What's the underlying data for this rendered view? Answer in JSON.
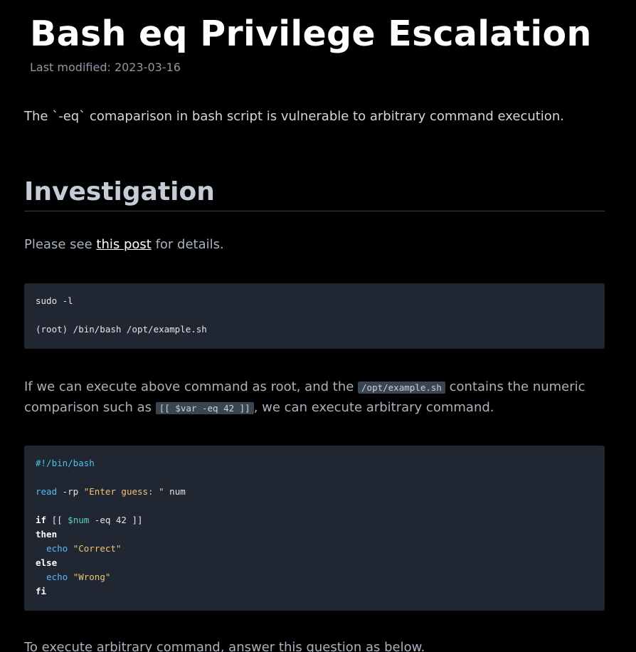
{
  "page": {
    "title": "Bash eq Privilege Escalation",
    "last_modified": "Last modified: 2023-03-16"
  },
  "intro": "The `-eq` comaparison in bash script is vulnerable to arbitrary command execution.",
  "investigation": {
    "heading": "Investigation",
    "see_prefix": "Please see ",
    "see_link": "this post",
    "see_suffix": " for details.",
    "code1": {
      "line1": "sudo -l",
      "line2": "(root) /bin/bash /opt/example.sh"
    },
    "para2": {
      "part1": "If we can execute above command as root, and the ",
      "code_a": "/opt/example.sh",
      "part2": " contains the numeric comparison such as ",
      "code_b": "[[ $var -eq 42 ]]",
      "part3": ", we can execute arbitrary command."
    },
    "code2": {
      "shebang": "#!/bin/bash",
      "read_kw": "read",
      "read_args": " -rp ",
      "read_prompt": "\"Enter guess: \"",
      "read_var": " num",
      "if_kw": "if",
      "if_open": " [[ ",
      "if_var": "$num",
      "if_rest": " -eq 42 ]]",
      "then_kw": "then",
      "echo1": "echo",
      "echo1_str": "\"Correct\"",
      "else_kw": "else",
      "echo2": "echo",
      "echo2_str": "\"Wrong\"",
      "fi_kw": "fi"
    },
    "para3": "To execute arbitrary command, answer this question as below."
  },
  "colors": {
    "background": "#000000",
    "title": "#ffffff",
    "code_background": "#202733",
    "link": "#ffffff"
  }
}
